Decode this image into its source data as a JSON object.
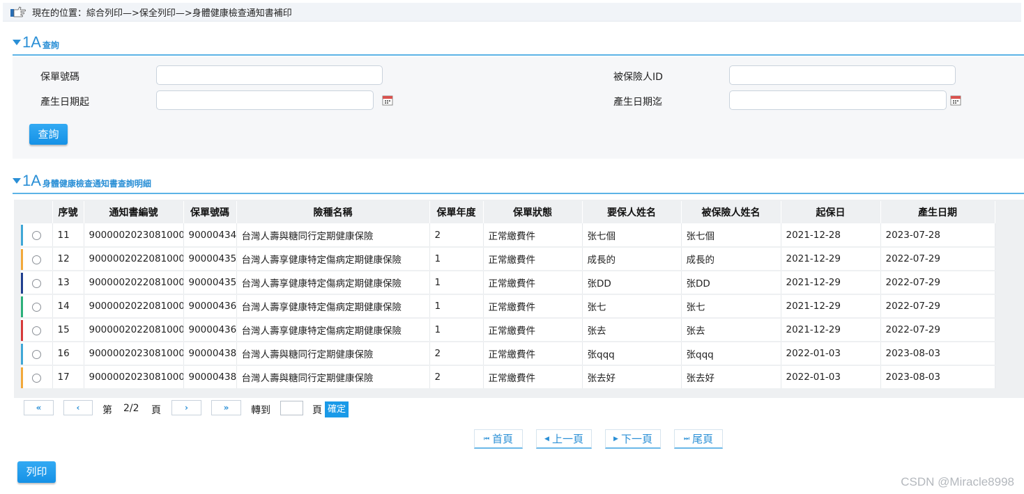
{
  "breadcrumb": {
    "text": "現在的位置：綜合列印—>保全列印—>身體健康檢查通知書補印"
  },
  "query_section": {
    "big": "1A",
    "title": "查詢"
  },
  "query_form": {
    "policy_no_label": "保單號碼",
    "policy_no_value": "",
    "insured_id_label": "被保險人ID",
    "insured_id_value": "",
    "date_from_label": "產生日期起",
    "date_from_value": "",
    "date_to_label": "產生日期迄",
    "date_to_value": "",
    "search_button": "查詢"
  },
  "detail_section": {
    "big": "1A",
    "title": "身體健康檢查通知書查詢明細"
  },
  "table": {
    "headers": [
      "",
      "序號",
      "通知書編號",
      "保單號碼",
      "險種名稱",
      "保單年度",
      "保單狀態",
      "要保人姓名",
      "被保險人姓名",
      "起保日",
      "產生日期"
    ],
    "rows": [
      {
        "seq": "11",
        "notice_no": "9000002023081000",
        "policy_no": "90000434",
        "product": "台灣人壽與糖同行定期健康保險",
        "year": "2",
        "status": "正常繳費件",
        "applicant": "张七個",
        "insured": "张七個",
        "start": "2021-12-28",
        "created": "2023-07-28",
        "stripe": "#3fa7d6"
      },
      {
        "seq": "12",
        "notice_no": "9000002022081000",
        "policy_no": "90000435",
        "product": "台灣人壽享健康特定傷病定期健康保險",
        "year": "1",
        "status": "正常繳費件",
        "applicant": "成長的",
        "insured": "成長的",
        "start": "2021-12-29",
        "created": "2022-07-29",
        "stripe": "#f2a93b"
      },
      {
        "seq": "13",
        "notice_no": "9000002022081000",
        "policy_no": "90000435",
        "product": "台灣人壽享健康特定傷病定期健康保險",
        "year": "1",
        "status": "正常繳費件",
        "applicant": "张DD",
        "insured": "张DD",
        "start": "2021-12-29",
        "created": "2022-07-29",
        "stripe": "#1f3f8f"
      },
      {
        "seq": "14",
        "notice_no": "9000002022081000",
        "policy_no": "90000436",
        "product": "台灣人壽享健康特定傷病定期健康保險",
        "year": "1",
        "status": "正常繳費件",
        "applicant": "张七",
        "insured": "张七",
        "start": "2021-12-29",
        "created": "2022-07-29",
        "stripe": "#2bb07a"
      },
      {
        "seq": "15",
        "notice_no": "9000002022081000",
        "policy_no": "90000436",
        "product": "台灣人壽享健康特定傷病定期健康保險",
        "year": "1",
        "status": "正常繳費件",
        "applicant": "张去",
        "insured": "张去",
        "start": "2021-12-29",
        "created": "2022-07-29",
        "stripe": "#d63a3a"
      },
      {
        "seq": "16",
        "notice_no": "9000002023081000",
        "policy_no": "90000438",
        "product": "台灣人壽與糖同行定期健康保險",
        "year": "2",
        "status": "正常繳費件",
        "applicant": "张qqq",
        "insured": "张qqq",
        "start": "2022-01-03",
        "created": "2023-08-03",
        "stripe": "#3fa7d6"
      },
      {
        "seq": "17",
        "notice_no": "9000002023081000",
        "policy_no": "90000438",
        "product": "台灣人壽與糖同行定期健康保險",
        "year": "2",
        "status": "正常繳費件",
        "applicant": "张去好",
        "insured": "张去好",
        "start": "2022-01-03",
        "created": "2023-08-03",
        "stripe": "#f2a93b"
      }
    ]
  },
  "pager": {
    "first": "«",
    "prev": "‹",
    "page_prefix": "第",
    "page_info": "2/2",
    "page_suffix": "頁",
    "next": "›",
    "last": "»",
    "goto_label": "轉到",
    "goto_value": "",
    "goto_suffix": "頁",
    "confirm": "確定"
  },
  "nav": {
    "first": "首頁",
    "prev": "上一頁",
    "next": "下一頁",
    "last": "尾頁"
  },
  "print_button": "列印",
  "watermark": "CSDN @Miracle8998",
  "colors": {
    "accent": "#2a8fd6",
    "button": "#1a9ae8"
  }
}
